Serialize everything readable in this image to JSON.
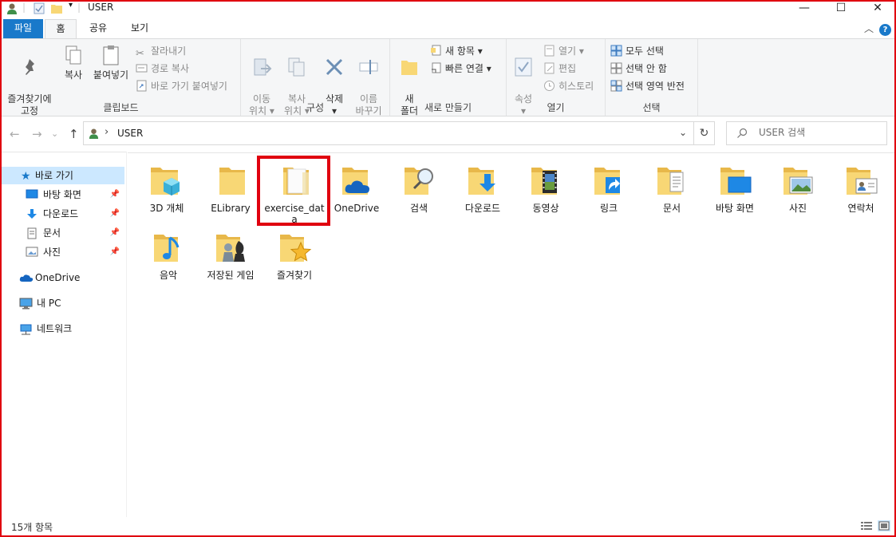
{
  "window": {
    "title": "USER",
    "minimize_glyph": "—",
    "maximize_glyph": "☐",
    "close_glyph": "✕"
  },
  "ribbon_tabs": [
    {
      "label": "파일",
      "active": false
    },
    {
      "label": "홈",
      "active": true
    },
    {
      "label": "공유",
      "active": false
    },
    {
      "label": "보기",
      "active": false
    }
  ],
  "ribbon": {
    "clipboard": {
      "group_label": "클립보드",
      "pin_quick": "즐겨찾기에\n고정",
      "copy": "복사",
      "paste": "붙여넣기",
      "cut": "잘라내기",
      "copy_path": "경로 복사",
      "paste_shortcut": "바로 가기 붙여넣기"
    },
    "organize": {
      "group_label": "구성",
      "move_to": "이동\n위치 ▾",
      "copy_to": "복사\n위치 ▾",
      "delete": "삭제\n▾",
      "rename": "이름\n바꾸기"
    },
    "new": {
      "group_label": "새로 만들기",
      "new_folder": "새\n폴더",
      "new_item": "새 항목 ▾",
      "easy_access": "빠른 연결 ▾"
    },
    "open": {
      "group_label": "열기",
      "properties": "속성\n▾",
      "open": "열기 ▾",
      "edit": "편집",
      "history": "히스토리"
    },
    "select": {
      "group_label": "선택",
      "select_all": "모두 선택",
      "select_none": "선택 안 함",
      "invert_selection": "선택 영역 반전"
    }
  },
  "address_bar": {
    "path": "USER",
    "search_placeholder": "USER 검색"
  },
  "nav_pane": {
    "quick_access": "바로 가기",
    "items": [
      {
        "label": "바탕 화면",
        "pinned": true
      },
      {
        "label": "다운로드",
        "pinned": true
      },
      {
        "label": "문서",
        "pinned": true
      },
      {
        "label": "사진",
        "pinned": true
      }
    ],
    "onedrive": "OneDrive",
    "this_pc": "내 PC",
    "network": "네트워크"
  },
  "folders": [
    {
      "label": "3D 개체",
      "icon": "3d-objects-folder-icon"
    },
    {
      "label": "ELibrary",
      "icon": "folder-icon"
    },
    {
      "label": "exercise_data",
      "icon": "folder-icon",
      "highlighted": true
    },
    {
      "label": "OneDrive",
      "icon": "onedrive-folder-icon"
    },
    {
      "label": "검색",
      "icon": "searches-folder-icon"
    },
    {
      "label": "다운로드",
      "icon": "downloads-folder-icon"
    },
    {
      "label": "동영상",
      "icon": "videos-folder-icon"
    },
    {
      "label": "링크",
      "icon": "links-folder-icon"
    },
    {
      "label": "문서",
      "icon": "documents-folder-icon"
    },
    {
      "label": "바탕 화면",
      "icon": "desktop-folder-icon"
    },
    {
      "label": "사진",
      "icon": "pictures-folder-icon"
    },
    {
      "label": "연락처",
      "icon": "contacts-folder-icon"
    },
    {
      "label": "음악",
      "icon": "music-folder-icon"
    },
    {
      "label": "저장된 게임",
      "icon": "saved-games-folder-icon"
    },
    {
      "label": "즐겨찾기",
      "icon": "favorites-folder-icon"
    }
  ],
  "status_bar": {
    "item_count": "15개 항목"
  },
  "colors": {
    "accent": "#1979ca",
    "highlight": "#e0000f",
    "folder": "#f8d775",
    "selection": "#cce8ff"
  }
}
